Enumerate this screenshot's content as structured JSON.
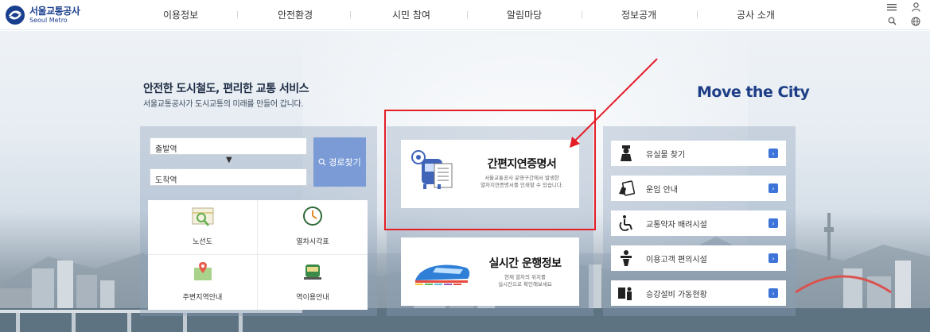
{
  "header": {
    "logo_ko": "서울교통공사",
    "logo_en": "Seoul Metro",
    "nav": [
      "이용정보",
      "안전환경",
      "시민 참여",
      "알림마당",
      "정보공개",
      "공사 소개"
    ]
  },
  "hero": {
    "title": "안전한 도시철도, 편리한 교통 서비스",
    "subtitle": "서울교통공사가 도시교통의 미래를 만들어 갑니다.",
    "slogan": "Move the City"
  },
  "route_search": {
    "departure_placeholder": "출발역",
    "arrival_placeholder": "도착역",
    "search_button": "경로찾기",
    "quick_links": [
      "노선도",
      "열차시각표",
      "주변지역안내",
      "역이용안내"
    ]
  },
  "center_cards": [
    {
      "title": "간편지연증명서",
      "desc_line1": "서울교통공사 운영구간에서 발생한",
      "desc_line2": "열차지연증명서를 인쇄할 수 있습니다."
    },
    {
      "title": "실시간 운행정보",
      "desc_line1": "현재 열차의 위치를",
      "desc_line2": "실시간으로 확인해보세요"
    }
  ],
  "right_menu": [
    "유실물 찾기",
    "운임 안내",
    "교통약자 배려시설",
    "이용고객 편의시설",
    "승강설비 가동현황"
  ],
  "colors": {
    "brand": "#1a3f8e",
    "route_button": "#7a9bd6",
    "menu_go": "#3d74d9",
    "annotation": "#e41e26"
  }
}
